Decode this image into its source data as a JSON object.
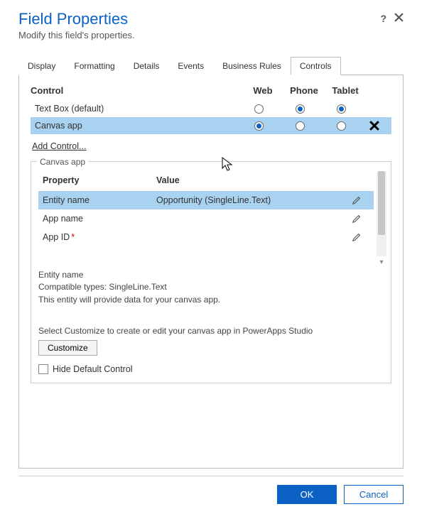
{
  "header": {
    "title": "Field Properties",
    "subtitle": "Modify this field's properties."
  },
  "tabs": [
    "Display",
    "Formatting",
    "Details",
    "Events",
    "Business Rules",
    "Controls"
  ],
  "activeTab": "Controls",
  "controlTable": {
    "headers": {
      "control": "Control",
      "web": "Web",
      "phone": "Phone",
      "tablet": "Tablet"
    },
    "rows": [
      {
        "name": "Text Box (default)",
        "web": false,
        "phone": true,
        "tablet": true,
        "selected": false,
        "removable": false
      },
      {
        "name": "Canvas app",
        "web": true,
        "phone": false,
        "tablet": false,
        "selected": true,
        "removable": true
      }
    ],
    "addLink": "Add Control..."
  },
  "propsSection": {
    "legend": "Canvas app",
    "headers": {
      "property": "Property",
      "value": "Value"
    },
    "rows": [
      {
        "property": "Entity name",
        "value": "Opportunity (SingleLine.Text)",
        "required": false,
        "selected": true
      },
      {
        "property": "App name",
        "value": "",
        "required": false,
        "selected": false
      },
      {
        "property": "App ID",
        "value": "",
        "required": true,
        "selected": false
      }
    ],
    "description": {
      "title": "Entity name",
      "line1": "Compatible types: SingleLine.Text",
      "line2": "This entity will provide data for your canvas app."
    },
    "infoLine": "Select Customize to create or edit your canvas app in PowerApps Studio",
    "customizeLabel": "Customize",
    "hideDefaultLabel": "Hide Default Control",
    "hideDefaultChecked": false
  },
  "footer": {
    "ok": "OK",
    "cancel": "Cancel"
  }
}
